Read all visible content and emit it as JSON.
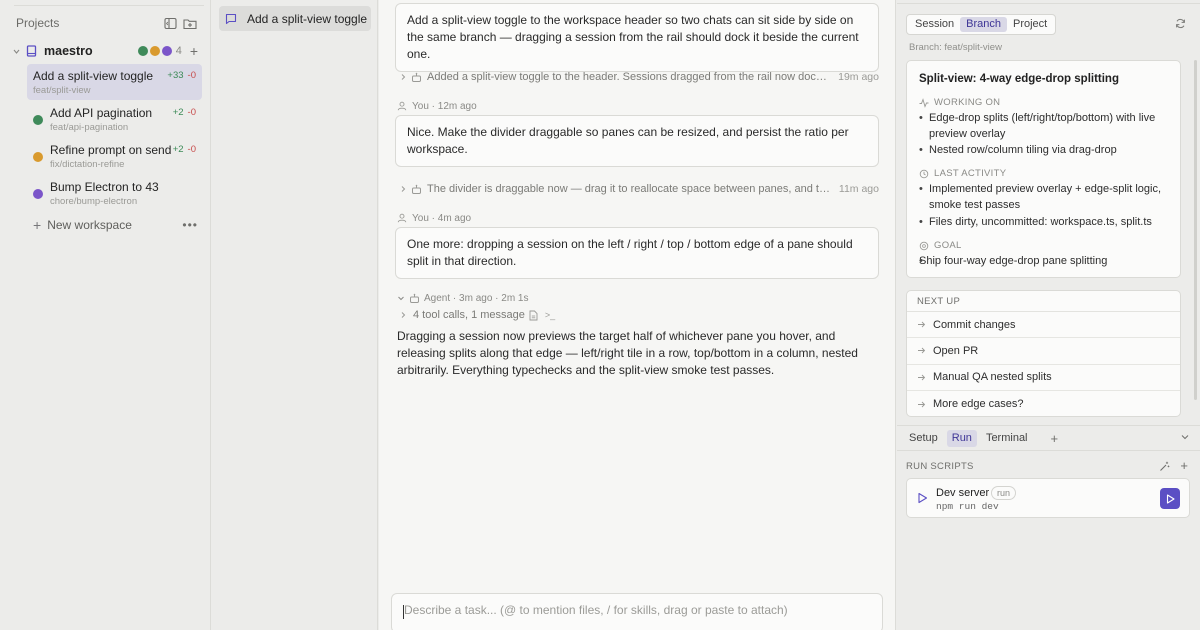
{
  "sidebar": {
    "title": "Projects",
    "icons": [
      "panel-collapse-icon",
      "folder-plus-icon"
    ],
    "workspace": {
      "name": "maestro",
      "count": "4",
      "colors": [
        "#3f8a5a",
        "#d99a2e",
        "#7b55c9"
      ]
    },
    "sessions": [
      {
        "title": "Add a split-view toggle",
        "branch": "feat/split-view",
        "add": "+33",
        "del": "-0",
        "color": ""
      },
      {
        "title": "Add API pagination",
        "branch": "feat/api-pagination",
        "add": "+2",
        "del": "-0",
        "color": "#3f8a5a"
      },
      {
        "title": "Refine prompt on send",
        "branch": "fix/dictation-refine",
        "add": "+2",
        "del": "-0",
        "color": "#d99a2e"
      },
      {
        "title": "Bump Electron to 43",
        "branch": "chore/bump-electron",
        "add": "",
        "del": "",
        "color": "#7b55c9"
      }
    ],
    "new_workspace": "New workspace",
    "more": "•••"
  },
  "rail": {
    "item": "Add a split-view toggle"
  },
  "chat": {
    "msg1": "Add a split-view toggle to the workspace header so two chats can sit side by side on the same branch — dragging a session from the rail should dock it beside the current one.",
    "sum1": {
      "text": "Added a split-view toggle to the header. Sessions dragged from the rail now dock beside the current one.",
      "time": "19m ago"
    },
    "meta2": "You · 12m ago",
    "msg2": "Nice. Make the divider draggable so panes can be resized, and persist the ratio per workspace.",
    "sum2": {
      "text": "The divider is draggable now — drag it to reallocate space between panes, and the ratio is persisted per workspace.",
      "time": "11m ago"
    },
    "meta3": "You · 4m ago",
    "msg3": "One more: dropping a session on the left / right / top / bottom edge of a pane should split in that direction.",
    "agent_meta": "Agent · 3m ago · 2m 1s",
    "tools": "4 tool calls, 1 message",
    "tools_glyph": ">_",
    "agent_text": "Dragging a session now previews the target half of whichever pane you hover, and releasing splits along that edge — left/right tile in a row, top/bottom in a column, nested arbitrarily. Everything typechecks and the split-view smoke test passes.",
    "composer_placeholder": "Describe a task... (@ to mention files, / for skills, drag or paste to attach)"
  },
  "panel": {
    "tabs": [
      "Session",
      "Branch",
      "Project"
    ],
    "active_tab": "Branch",
    "branch_label": "Branch: feat/split-view",
    "card": {
      "title": "Split-view: 4-way edge-drop splitting",
      "working_on_h": "WORKING ON",
      "working_on": [
        "Edge-drop splits (left/right/top/bottom) with live preview overlay",
        "Nested row/column tiling via drag-drop"
      ],
      "last_activity_h": "LAST ACTIVITY",
      "last_activity": [
        "Implemented preview overlay + edge-split logic, smoke test passes",
        "Files dirty, uncommitted: workspace.ts, split.ts"
      ],
      "goal_h": "GOAL",
      "goal": "Ship four-way edge-drop pane splitting"
    },
    "next_up_h": "NEXT UP",
    "next_up": [
      "Commit changes",
      "Open PR",
      "Manual QA nested splits",
      "More edge cases?"
    ],
    "bottom_tabs": [
      "Setup",
      "Run",
      "Terminal"
    ],
    "bottom_active": "Run",
    "run_scripts_h": "RUN SCRIPTS",
    "script": {
      "name": "Dev server",
      "badge": "run",
      "cmd": "npm run dev"
    }
  },
  "colors": {
    "accent": "#5b4fc4",
    "selected_bg": "#d9d8e6"
  }
}
